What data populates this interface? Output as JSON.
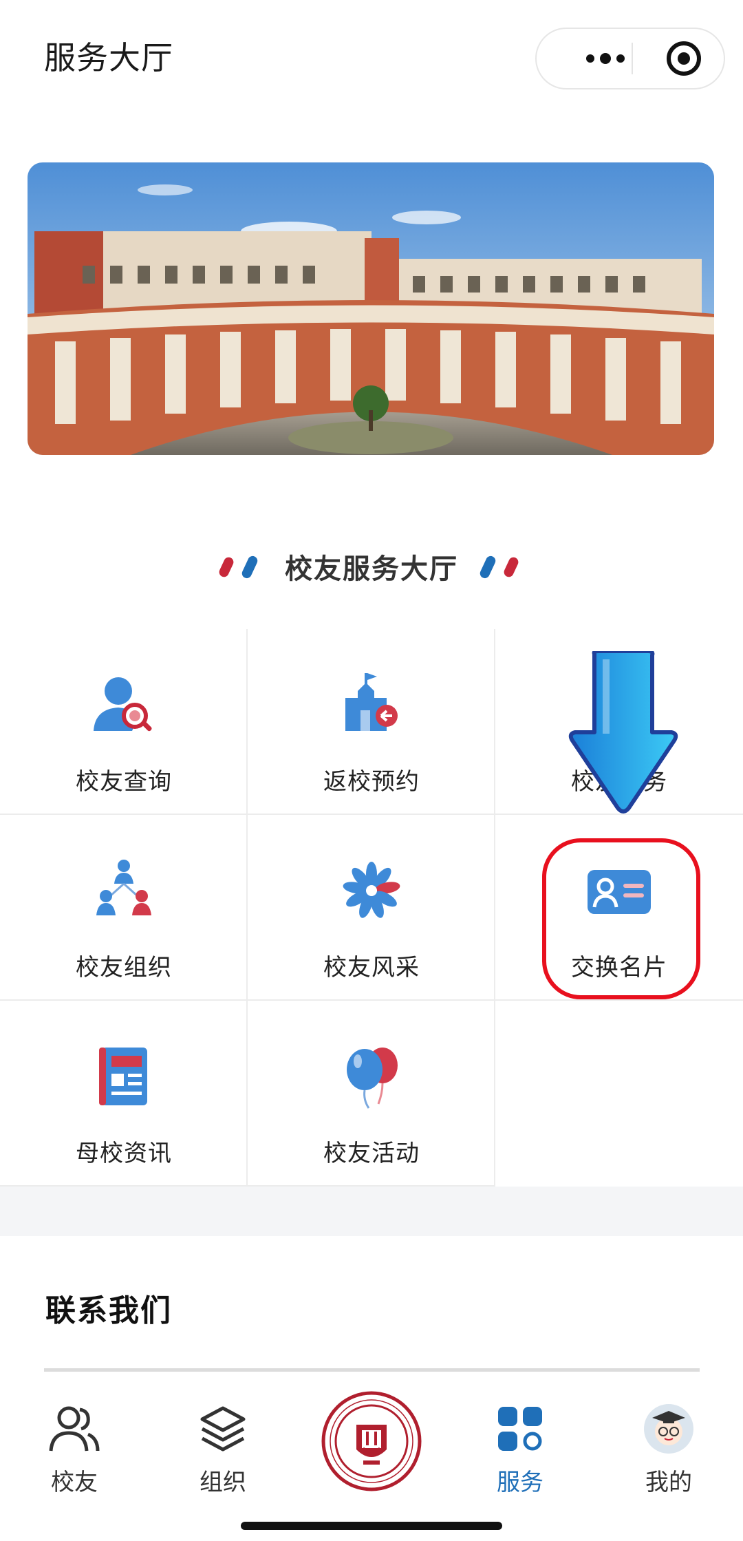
{
  "header": {
    "title": "服务大厅",
    "more_icon": "more-dots-icon",
    "target_icon": "mini-program-target-icon"
  },
  "banner": {
    "icon": "campus-building-photo"
  },
  "section": {
    "title": "校友服务大厅"
  },
  "grid": {
    "items": [
      {
        "label": "校友查询",
        "icon": "alumni-search-icon"
      },
      {
        "label": "返校预约",
        "icon": "campus-return-icon"
      },
      {
        "label": "校友服务",
        "icon": "alumni-service-icon"
      },
      {
        "label": "校友组织",
        "icon": "alumni-organization-icon"
      },
      {
        "label": "校友风采",
        "icon": "alumni-showcase-icon"
      },
      {
        "label": "交换名片",
        "icon": "business-card-icon"
      },
      {
        "label": "母校资讯",
        "icon": "school-news-icon"
      },
      {
        "label": "校友活动",
        "icon": "alumni-events-icon"
      }
    ],
    "obscured_label_visible": "校",
    "obscured_label_visible_end": "务"
  },
  "contact": {
    "title": "联系我们"
  },
  "tabbar": {
    "items": [
      {
        "label": "校友",
        "icon": "people-icon",
        "active": false
      },
      {
        "label": "组织",
        "icon": "layers-icon",
        "active": false
      },
      {
        "label": "",
        "icon": "university-logo",
        "active": false
      },
      {
        "label": "服务",
        "icon": "grid-apps-icon",
        "active": true
      },
      {
        "label": "我的",
        "icon": "avatar-icon",
        "active": false
      }
    ]
  },
  "colors": {
    "accent_blue": "#1f6fb8",
    "highlight_red": "#e8101e",
    "icon_red": "#c8283a"
  }
}
